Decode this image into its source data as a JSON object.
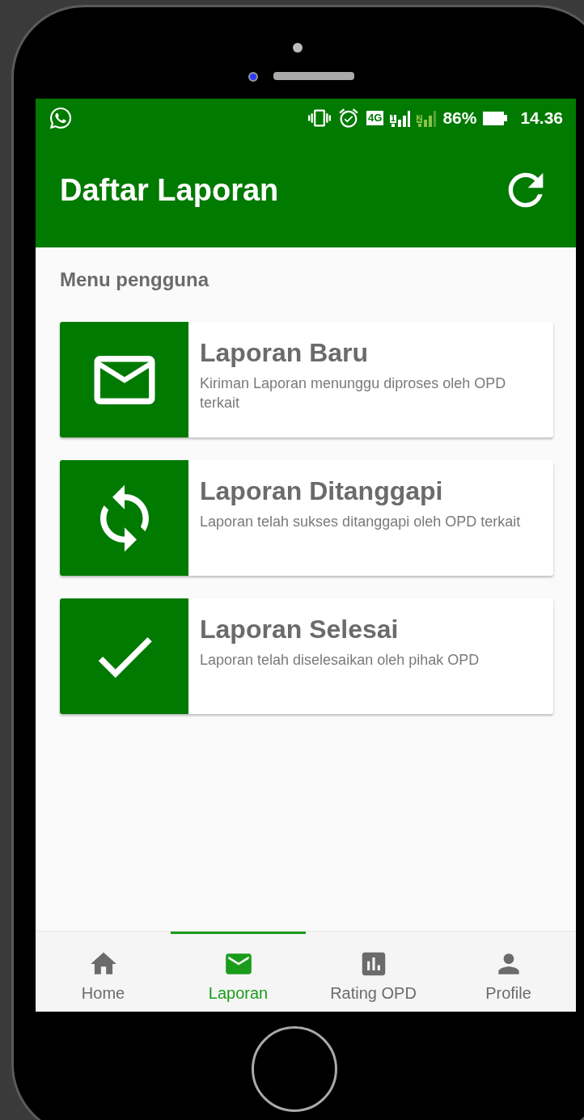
{
  "status_bar": {
    "network": "4G",
    "sim_1": "1",
    "sim_2": "2",
    "battery": "86%",
    "time": "14.36"
  },
  "app_bar": {
    "title": "Daftar Laporan"
  },
  "section_title": "Menu pengguna",
  "menu_cards": [
    {
      "kind": "mail",
      "title": "Laporan Baru",
      "description": "Kiriman Laporan menunggu diproses oleh OPD terkait"
    },
    {
      "kind": "sync",
      "title": "Laporan Ditanggapi",
      "description": "Laporan telah sukses ditanggapi oleh OPD terkait"
    },
    {
      "kind": "done",
      "title": "Laporan Selesai",
      "description": "Laporan telah diselesaikan oleh pihak OPD"
    }
  ],
  "bottom_nav": [
    {
      "kind": "home",
      "label": "Home",
      "selected": false
    },
    {
      "kind": "mail",
      "label": "Laporan",
      "selected": true
    },
    {
      "kind": "chart",
      "label": "Rating OPD",
      "selected": false
    },
    {
      "kind": "person",
      "label": "Profile",
      "selected": false
    }
  ]
}
